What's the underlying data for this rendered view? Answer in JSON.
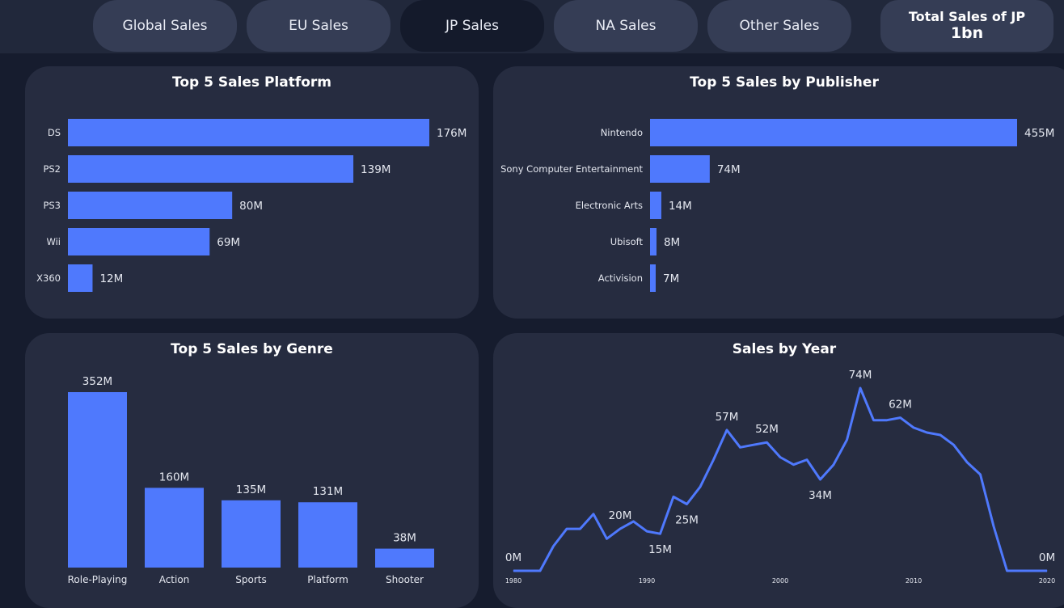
{
  "tabs": [
    {
      "label": "Global Sales",
      "active": false
    },
    {
      "label": "EU Sales",
      "active": false
    },
    {
      "label": "JP Sales",
      "active": true
    },
    {
      "label": "NA Sales",
      "active": false
    },
    {
      "label": "Other Sales",
      "active": false
    }
  ],
  "kpi": {
    "label": "Total Sales of JP",
    "value": "1bn"
  },
  "colors": {
    "bar": "#4f79fd",
    "line": "#4f79fd",
    "background": "#161c2e",
    "card": "#262c40"
  },
  "chart_data": [
    {
      "type": "bar",
      "orientation": "horizontal",
      "title": "Top 5 Sales Platform",
      "categories": [
        "DS",
        "PS2",
        "PS3",
        "Wii",
        "X360"
      ],
      "values": [
        176,
        139,
        80,
        69,
        12
      ],
      "data_labels": [
        "176M",
        "139M",
        "80M",
        "69M",
        "12M"
      ]
    },
    {
      "type": "bar",
      "orientation": "horizontal",
      "title": "Top 5 Sales by Publisher",
      "categories": [
        "Nintendo",
        "Sony Computer Entertainment",
        "Electronic Arts",
        "Ubisoft",
        "Activision"
      ],
      "values": [
        455,
        74,
        14,
        8,
        7
      ],
      "data_labels": [
        "455M",
        "74M",
        "14M",
        "8M",
        "7M"
      ]
    },
    {
      "type": "bar",
      "orientation": "vertical",
      "title": "Top 5 Sales by Genre",
      "categories": [
        "Role-Playing",
        "Action",
        "Sports",
        "Platform",
        "Shooter"
      ],
      "values": [
        352,
        160,
        135,
        131,
        38
      ],
      "data_labels": [
        "352M",
        "160M",
        "135M",
        "131M",
        "38M"
      ]
    },
    {
      "type": "line",
      "title": "Sales by Year",
      "x_ticks": [
        "1980",
        "1990",
        "2000",
        "2010",
        "2020"
      ],
      "xlim": [
        1980,
        2020
      ],
      "x": [
        1980,
        1981,
        1982,
        1983,
        1984,
        1985,
        1986,
        1987,
        1988,
        1989,
        1990,
        1991,
        1992,
        1993,
        1994,
        1995,
        1996,
        1997,
        1998,
        1999,
        2000,
        2001,
        2002,
        2003,
        2004,
        2005,
        2006,
        2007,
        2008,
        2009,
        2010,
        2011,
        2012,
        2013,
        2014,
        2015,
        2016,
        2017,
        2018,
        2019,
        2020
      ],
      "y": [
        0,
        0,
        0,
        10,
        17,
        17,
        23,
        13,
        17,
        20,
        16,
        15,
        30,
        27,
        34,
        45,
        57,
        50,
        51,
        52,
        46,
        43,
        45,
        37,
        43,
        53,
        74,
        61,
        61,
        62,
        58,
        56,
        55,
        51,
        44,
        39,
        18,
        0,
        0,
        0,
        0
      ],
      "point_labels": [
        {
          "x": 1980,
          "label": "0M"
        },
        {
          "x": 1988,
          "label": "20M"
        },
        {
          "x": 1991,
          "label": "15M"
        },
        {
          "x": 1993,
          "label": "25M"
        },
        {
          "x": 1996,
          "label": "57M"
        },
        {
          "x": 1999,
          "label": "52M"
        },
        {
          "x": 2003,
          "label": "34M"
        },
        {
          "x": 2006,
          "label": "74M"
        },
        {
          "x": 2009,
          "label": "62M"
        },
        {
          "x": 2020,
          "label": "0M"
        }
      ]
    }
  ]
}
